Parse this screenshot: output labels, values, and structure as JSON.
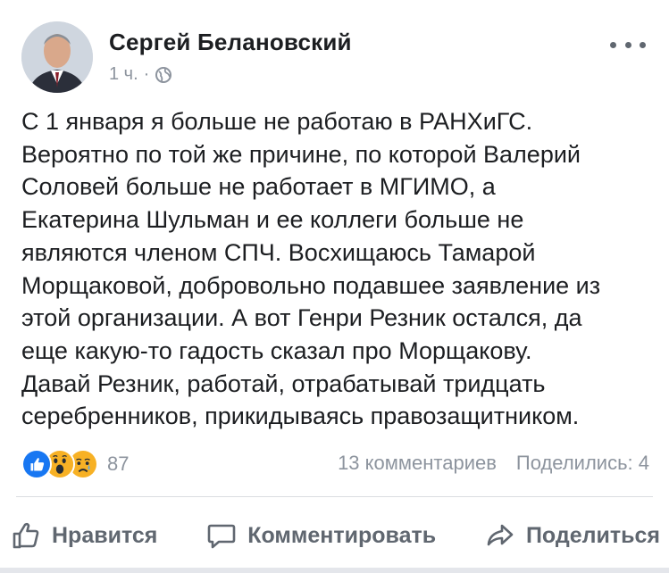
{
  "post": {
    "author": "Сергей Белановский",
    "time": "1 ч.",
    "separator": "·",
    "privacy_icon": "globe-icon",
    "more_icon": "more-dots-icon",
    "text_lines": [
      "С 1 января я больше не работаю в РАНХиГС.",
      "Вероятно по той же причине, по которой Валерий",
      "Соловей больше не работает в МГИМО, а",
      "Екатерина Шульман и ее коллеги больше не",
      "являются членом СПЧ. Восхищаюсь Тамарой",
      "Морщаковой, добровольно подавшее заявление из",
      "этой организации. А вот Генри Резник остался, да",
      "еще какую-то гадость сказал про Морщакову.",
      "Давай Резник, работай, отрабатывай тридцать",
      "серебренников, прикидываясь правозащитником."
    ]
  },
  "reactions": {
    "icons": [
      "like-reaction-icon",
      "wow-reaction-icon",
      "sad-reaction-icon"
    ],
    "count": "87",
    "comments": "13 комментариев",
    "shares": "Поделились: 4"
  },
  "actions": {
    "like": "Нравится",
    "comment": "Комментировать",
    "share": "Поделиться"
  },
  "colors": {
    "text": "#1c1e21",
    "secondary": "#8d949e",
    "action": "#606770",
    "like_blue": "#1877f2",
    "emoji_yellow": "#f7b125"
  }
}
